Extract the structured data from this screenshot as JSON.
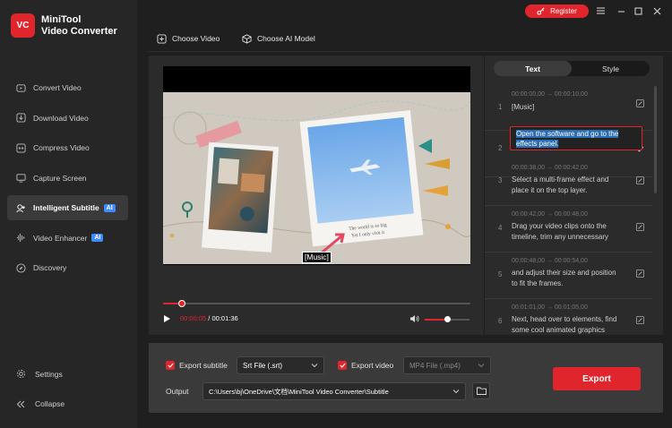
{
  "app": {
    "name_line1": "MiniTool",
    "name_line2": "Video Converter",
    "logo_text": "VC"
  },
  "titlebar": {
    "register_label": "Register"
  },
  "toolbar": {
    "choose_video": "Choose Video",
    "choose_ai_model": "Choose AI Model"
  },
  "sidebar": {
    "items": [
      {
        "label": "Convert Video",
        "icon": "convert-icon"
      },
      {
        "label": "Download Video",
        "icon": "download-icon"
      },
      {
        "label": "Compress Video",
        "icon": "compress-icon"
      },
      {
        "label": "Capture Screen",
        "icon": "capture-icon"
      },
      {
        "label": "Intelligent Subtitle",
        "icon": "subtitle-icon",
        "badge": "AI",
        "active": true
      },
      {
        "label": "Video Enhancer",
        "icon": "enhancer-icon",
        "badge": "AI"
      },
      {
        "label": "Discovery",
        "icon": "discovery-icon"
      }
    ],
    "settings": "Settings",
    "collapse": "Collapse"
  },
  "player": {
    "subtitle_overlay": "[Music]",
    "current_time": "00:00:05",
    "separator": " / ",
    "total_time": "00:01:36",
    "progress": 0.06,
    "volume": 0.5,
    "photo_caption_1": "The world is so big",
    "photo_caption_2": "Yet I only visit it"
  },
  "subtitle_panel": {
    "tabs": [
      "Text",
      "Style"
    ],
    "rows": [
      {
        "num": "1",
        "time": "00:00:00,00 → 00:00:10,00",
        "text": "[Music]"
      },
      {
        "num": "2",
        "time": "",
        "text": "Open the software and go to the effects panel."
      },
      {
        "num": "3",
        "time": "00:00:38,00 → 00:00:42,00",
        "text": "Select a multi-frame effect and place it on the top layer."
      },
      {
        "num": "4",
        "time": "00:00:42,00 → 00:00:48,00",
        "text": "Drag your video clips onto the timeline, trim any unnecessary parts,"
      },
      {
        "num": "5",
        "time": "00:00:48,00 → 00:00:54,00",
        "text": "and adjust their size and position to fit the frames."
      },
      {
        "num": "6",
        "time": "00:01:01,00 → 00:01:05,00",
        "text": "Next, head over to elements, find some cool animated graphics"
      }
    ]
  },
  "export": {
    "export_subtitle_label": "Export subtitle",
    "subtitle_format": "Srt File (.srt)",
    "export_video_label": "Export video",
    "video_format": "MP4 File (.mp4)",
    "output_label": "Output",
    "output_path": "C:\\Users\\bj\\OneDrive\\文档\\MiniTool Video Converter\\Subtitle",
    "export_button": "Export"
  },
  "colors": {
    "accent": "#e0262c",
    "ai_badge": "#3d8bff",
    "selection": "#2a6db5"
  }
}
